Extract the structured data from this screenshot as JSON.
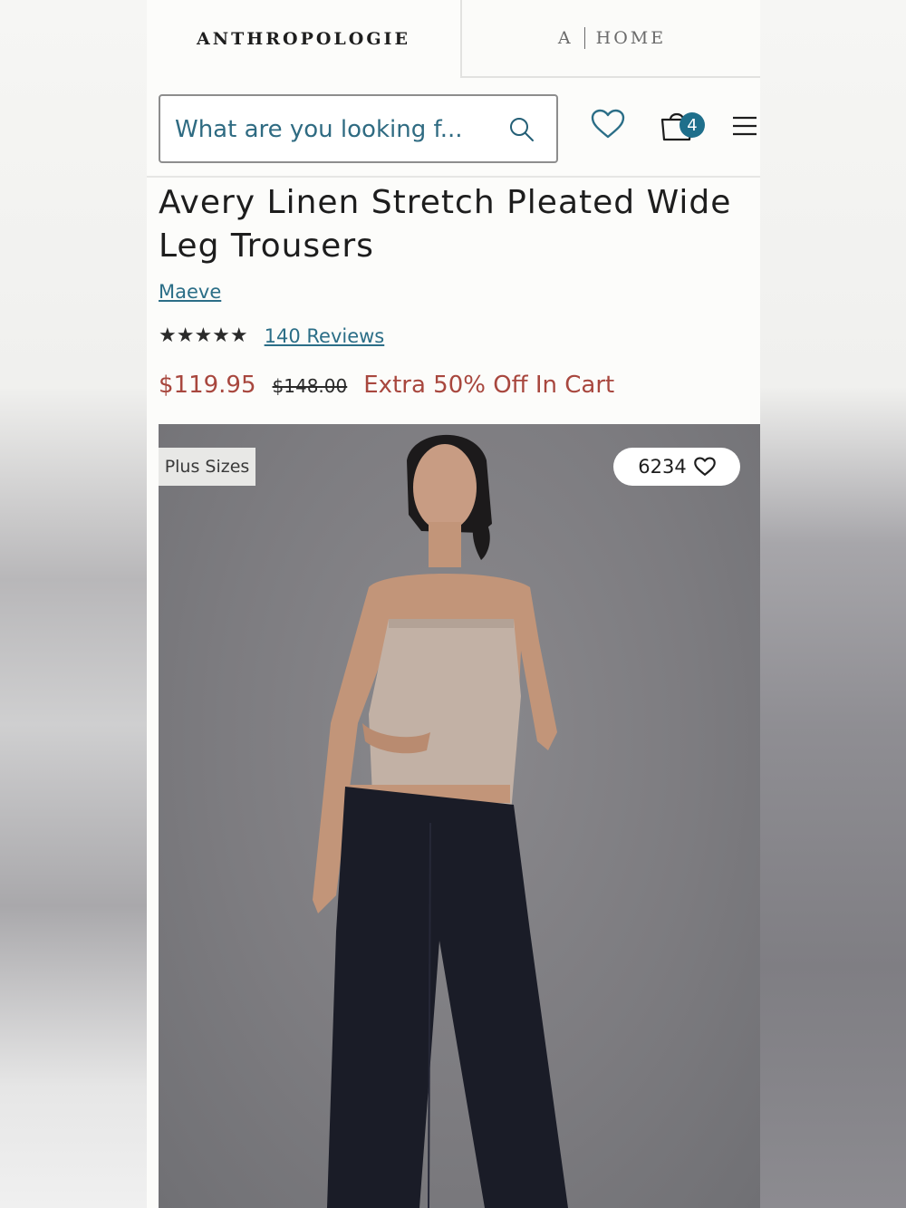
{
  "brand_tabs": {
    "anthropologie": "ANTHROPOLOGIE",
    "home_prefix": "A",
    "home_label": "HOME"
  },
  "header": {
    "search_placeholder": "What are you looking f...",
    "cart_count": "4",
    "icons": [
      "search-icon",
      "heart-icon",
      "shopping-bag-icon",
      "hamburger-menu-icon"
    ]
  },
  "product": {
    "title": "Avery Linen Stretch Pleated Wide Leg Trousers",
    "brand": "Maeve",
    "rating_stars": "★★★★★",
    "rating_value": 4.5,
    "reviews": "140 Reviews",
    "sale_price": "$119.95",
    "original_price": "$148.00",
    "promo": "Extra 50% Off In Cart"
  },
  "gallery": {
    "badge": "Plus Sizes",
    "likes": "6234"
  },
  "colors": {
    "accent": "#1f6f8b",
    "link": "#2b6e87",
    "sale": "#a8473e"
  }
}
